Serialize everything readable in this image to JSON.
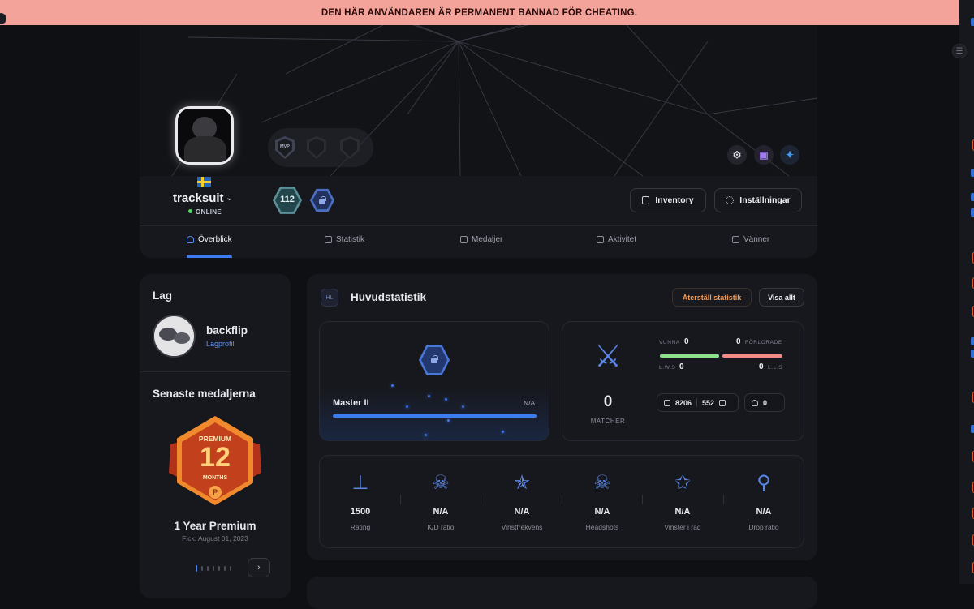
{
  "banner": {
    "text": "DEN HÄR ANVÄNDAREN ÄR PERMANENT BANNAD FÖR CHEATING."
  },
  "profile": {
    "username": "tracksuit",
    "status": "ONLINE",
    "country_flag": "sweden-flag",
    "level": "112",
    "badges": [
      "MVP",
      "locked-badge",
      "locked-badge"
    ]
  },
  "actions": {
    "inventory": "Inventory",
    "settings": "Inställningar"
  },
  "social": [
    "steam-icon",
    "twitch-icon",
    "twitter-icon"
  ],
  "tabs": [
    {
      "label": "Överblick",
      "icon": "user-icon",
      "active": true
    },
    {
      "label": "Statistik",
      "icon": "bar-chart-icon",
      "active": false
    },
    {
      "label": "Medaljer",
      "icon": "medal-icon",
      "active": false
    },
    {
      "label": "Aktivitet",
      "icon": "activity-icon",
      "active": false
    },
    {
      "label": "Vänner",
      "icon": "friends-icon",
      "active": false
    }
  ],
  "team": {
    "heading": "Lag",
    "name": "backflip",
    "link": "Lagprofil"
  },
  "medals": {
    "heading": "Senaste medaljerna",
    "badge_top": "PREMIUM",
    "badge_number": "12",
    "badge_bottom": "MONTHS",
    "badge_logo": "P",
    "name": "1 Year Premium",
    "date": "Fick: August 01, 2023",
    "page_count": 7,
    "current_page": 1
  },
  "main": {
    "icon_text": "HL",
    "title": "Huvudstatistik",
    "reset_label": "Återställ statistik",
    "view_all_label": "Visa allt"
  },
  "rank": {
    "name": "Master II",
    "value": "N/A",
    "progress": 1.0
  },
  "matches": {
    "count": "0",
    "label": "MATCHER",
    "won_label": "VUNNA",
    "won": "0",
    "lost_label": "FÖRLORADE",
    "lost": "0",
    "lws_label": "L.W.S",
    "lws": "0",
    "lls_label": "L.L.S",
    "lls": "0",
    "likes": "8206",
    "dislikes": "552",
    "trophies": "0"
  },
  "stats": [
    {
      "value": "1500",
      "label": "Rating",
      "icon": "podium-icon"
    },
    {
      "value": "N/A",
      "label": "K/D ratio",
      "icon": "skull-grave-icon"
    },
    {
      "value": "N/A",
      "label": "Vinstfrekvens",
      "icon": "laurel-stars-icon"
    },
    {
      "value": "N/A",
      "label": "Headshots",
      "icon": "skull-target-icon"
    },
    {
      "value": "N/A",
      "label": "Vinster i rad",
      "icon": "stars-stack-icon"
    },
    {
      "value": "N/A",
      "label": "Drop ratio",
      "icon": "running-man-icon"
    }
  ],
  "colors": {
    "accent": "#3d7bf0",
    "ban": "#f4a39b",
    "reset": "#f19b59",
    "win": "#8ee08a",
    "loss": "#f28a86"
  }
}
